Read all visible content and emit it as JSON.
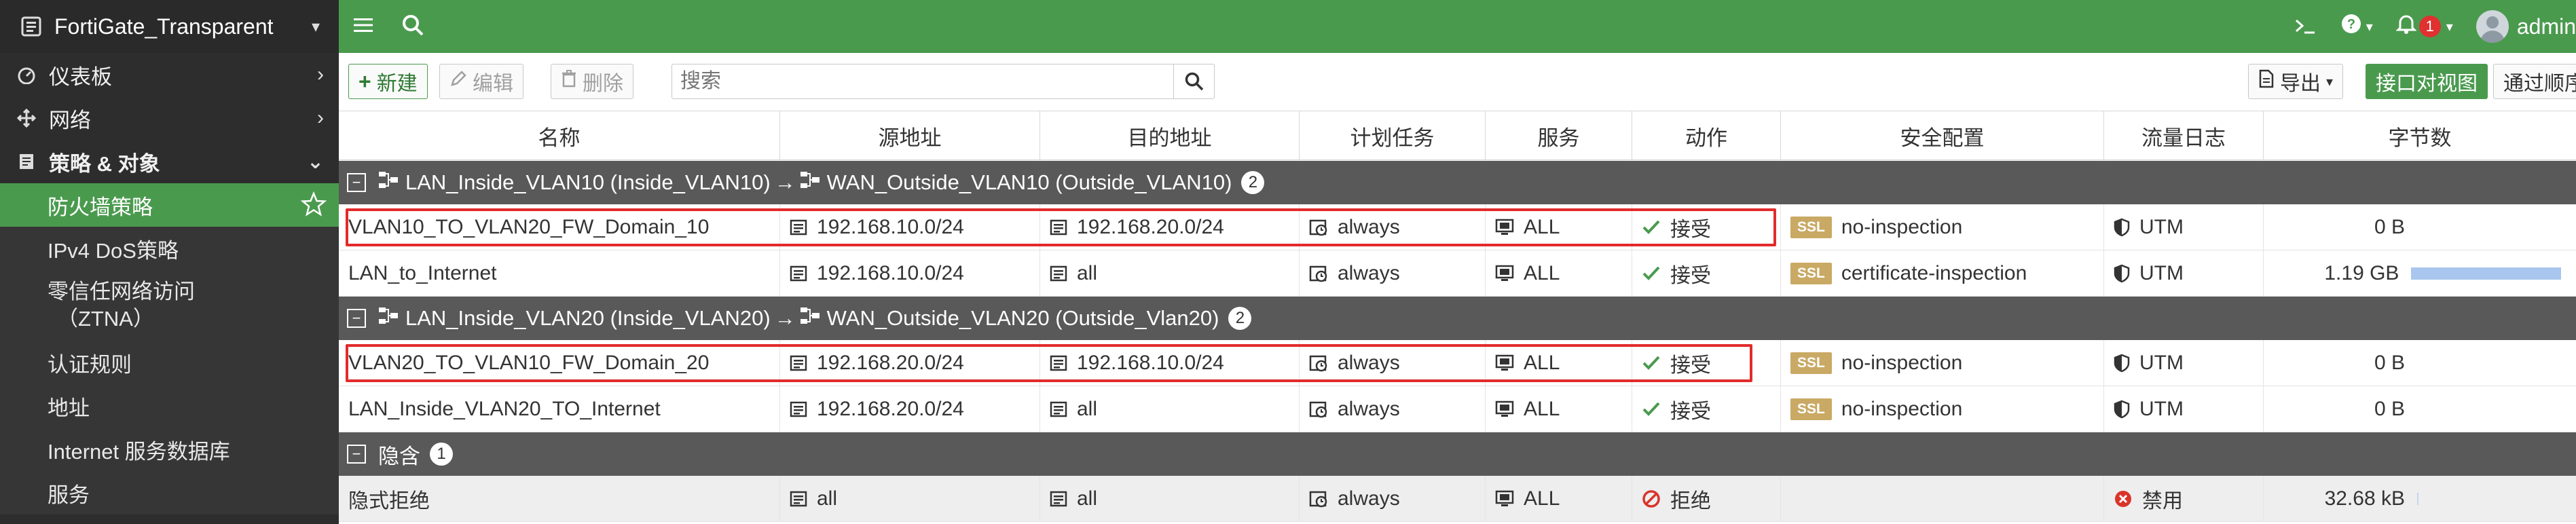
{
  "sidebar": {
    "brand": "FortiGate_Transparent",
    "items": [
      {
        "label": "仪表板",
        "icon": "dashboard-icon"
      },
      {
        "label": "网络",
        "icon": "network-icon"
      },
      {
        "label": "策略 & 对象",
        "icon": "policy-icon"
      }
    ],
    "sub_items": [
      {
        "label": "防火墙策略"
      },
      {
        "label": "IPv4 DoS策略"
      },
      {
        "label": "零信任网络访问",
        "label2": "（ZTNA）"
      },
      {
        "label": "认证规则"
      },
      {
        "label": "地址"
      },
      {
        "label": "Internet 服务数据库"
      },
      {
        "label": "服务"
      }
    ]
  },
  "topbar": {
    "notification_count": "1",
    "user": "admin"
  },
  "toolbar": {
    "new_label": "新建",
    "edit_label": "编辑",
    "delete_label": "删除",
    "search_placeholder": "搜索",
    "export_label": "导出",
    "view_interface_pair": "接口对视图",
    "view_sequence": "通过顺序"
  },
  "table": {
    "headers": [
      "名称",
      "源地址",
      "目的地址",
      "计划任务",
      "服务",
      "动作",
      "安全配置",
      "流量日志",
      "字节数"
    ],
    "groups": [
      {
        "label": "LAN_Inside_VLAN10 (Inside_VLAN10)",
        "arrow": "→",
        "dest": "WAN_Outside_VLAN10 (Outside_VLAN10)",
        "count": "2",
        "rows": [
          {
            "name": "VLAN10_TO_VLAN20_FW_Domain_10",
            "src": "192.168.10.0/24",
            "dst": "192.168.20.0/24",
            "schedule": "always",
            "service": "ALL",
            "action": "接受",
            "security": "no-inspection",
            "log": "UTM",
            "bytes": "0 B"
          },
          {
            "name": "LAN_to_Internet",
            "src": "192.168.10.0/24",
            "dst": "all",
            "schedule": "always",
            "service": "ALL",
            "action": "接受",
            "security": "certificate-inspection",
            "log": "UTM",
            "bytes": "1.19 GB"
          }
        ]
      },
      {
        "label": "LAN_Inside_VLAN20 (Inside_VLAN20)",
        "arrow": "→",
        "dest": "WAN_Outside_VLAN20 (Outside_Vlan20)",
        "count": "2",
        "rows": [
          {
            "name": "VLAN20_TO_VLAN10_FW_Domain_20",
            "src": "192.168.20.0/24",
            "dst": "192.168.10.0/24",
            "schedule": "always",
            "service": "ALL",
            "action": "接受",
            "security": "no-inspection",
            "log": "UTM",
            "bytes": "0 B"
          },
          {
            "name": "LAN_Inside_VLAN20_TO_Internet",
            "src": "192.168.20.0/24",
            "dst": "all",
            "schedule": "always",
            "service": "ALL",
            "action": "接受",
            "security": "no-inspection",
            "log": "UTM",
            "bytes": "0 B"
          }
        ]
      },
      {
        "label": "隐含",
        "count": "1",
        "rows": [
          {
            "name": "隐式拒绝",
            "src": "all",
            "dst": "all",
            "schedule": "always",
            "service": "ALL",
            "action": "拒绝",
            "security": "",
            "log": "禁用",
            "bytes": "32.68 kB"
          }
        ]
      }
    ],
    "ssl_tag": "SSL"
  },
  "colors": {
    "brand_green": "#4a9a4e",
    "sidebar_bg": "#2d2d2d",
    "group_row_bg": "#595959",
    "highlight_red": "#e22b2b",
    "ssl_tag": "#c9a964"
  }
}
